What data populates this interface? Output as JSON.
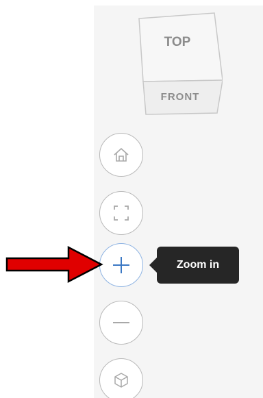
{
  "viewcube": {
    "top_label": "TOP",
    "front_label": "FRONT"
  },
  "navigation": {
    "buttons": [
      {
        "name": "home",
        "icon": "home-icon"
      },
      {
        "name": "fit-to-view",
        "icon": "fit-frame-icon"
      },
      {
        "name": "zoom-in",
        "icon": "plus-icon",
        "active": true
      },
      {
        "name": "zoom-out",
        "icon": "minus-icon"
      },
      {
        "name": "orbit",
        "icon": "cube-orbit-icon"
      }
    ]
  },
  "tooltip": {
    "text": "Zoom in"
  },
  "annotation": {
    "arrow_color": "#e00000"
  },
  "colors": {
    "panel_background": "#f5f5f5",
    "button_border": "#b9b9b9",
    "active_border": "#8fb4e3",
    "active_icon": "#3b78c4",
    "tooltip_background": "#262626"
  }
}
